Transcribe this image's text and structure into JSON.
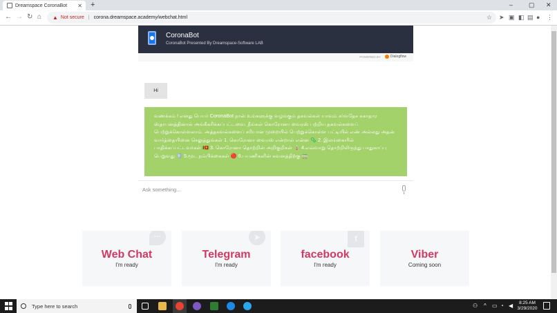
{
  "browser": {
    "tab_title": "Dreamspace CoronaBot",
    "new_tab_label": "+",
    "window_controls": [
      "–",
      "▢",
      "✕"
    ],
    "security_label": "Not secure",
    "url": "corona.dreamspace.academy/webchat.html"
  },
  "chat": {
    "bot_name": "CoronaBot",
    "bot_subtitle": "CoronaBot Presented By Dreamspace-Software LAB",
    "powered_by": "POWERED BY",
    "powered_brand": "Dialogflow",
    "messages": [
      {
        "from": "user",
        "text": "Hi"
      },
      {
        "from": "bot",
        "text": "வணக்கம் ! எனது பெயர் CoronaBot நான் உங்களுக்கு வழங்கும் தகவல்கள் யாவும் சர்வதேச சுகாதார ஸ்தாபனத்தினால் அங்கீகரிக்கப்பட்டவை. நீங்கள் கொரோனா வைரஸ் பற்றிய தகவல்களைப் பெற்றுக்கொள்ளலாம். அத்தகவல்களைப் சரியான முறையில் பெற்றுக்கொள்ள பட்டியில் எண் அல்லது அதன் வார்த்தையினை செலுத்துங்கள் 1. கொரோனா வைரஸ் என்றால் என்ன 🦠 2. இலங்கையில் பாதிக்கப்பட்டவர்கள் 🇱🇰 3. கொரோனா தொற்றின் அறிகுறிகள் 🌡️ 4.எவ்வாறு தொற்றிலிருந்து பாதுகாப்பு பெறுவது 🛡️ 5.மூட நம்பிக்கைகள் 🔴 6.பயணிகளின் கவனத்திற்கு 🚃"
      }
    ],
    "input_placeholder": "Ask something..."
  },
  "channels": [
    {
      "name": "Web Chat",
      "status": "I'm ready",
      "icon": "chat-bubble-icon"
    },
    {
      "name": "Telegram",
      "status": "I'm ready",
      "icon": "telegram-icon"
    },
    {
      "name": "facebook",
      "status": "I'm ready",
      "icon": "facebook-icon"
    },
    {
      "name": "Viber",
      "status": "Coming soon",
      "icon": "viber-icon"
    }
  ],
  "taskbar": {
    "search_placeholder": "Type here to search",
    "time": "8:25 AM",
    "date": "3/29/2020"
  },
  "colors": {
    "header_bg": "#2b3040",
    "bot_bubble": "#a3d16a",
    "user_bubble": "#e4e4e4",
    "channel_name": "#d33960"
  }
}
